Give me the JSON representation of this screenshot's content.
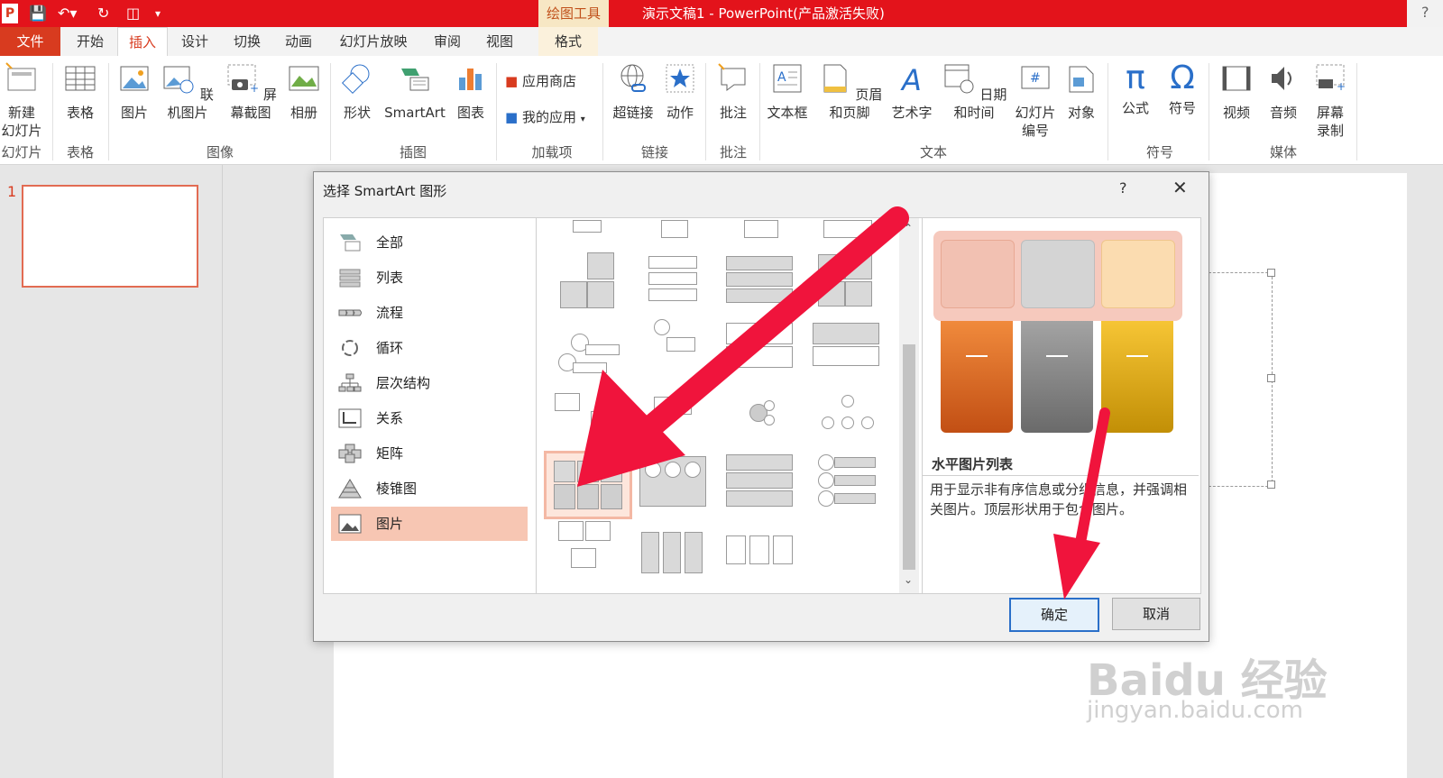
{
  "window": {
    "title": "演示文稿1 - PowerPoint(产品激活失败)",
    "context_tab_header": "绘图工具",
    "help": "?"
  },
  "tabs": [
    {
      "label": "文件"
    },
    {
      "label": "开始"
    },
    {
      "label": "插入"
    },
    {
      "label": "设计"
    },
    {
      "label": "切换"
    },
    {
      "label": "动画"
    },
    {
      "label": "幻灯片放映"
    },
    {
      "label": "审阅"
    },
    {
      "label": "视图"
    },
    {
      "label": "格式"
    }
  ],
  "active_tab": "插入",
  "ribbon": {
    "buttons": {
      "new_slide": "新建\n幻灯片",
      "table": "表格",
      "picture": "图片",
      "online_picture": "联机图片",
      "screenshot": "屏幕截图",
      "album": "相册",
      "shapes": "形状",
      "smartart": "SmartArt",
      "chart": "图表",
      "store": "应用商店",
      "my_apps": "我的应用",
      "hyperlink": "超链接",
      "action": "动作",
      "comment": "批注",
      "textbox": "文本框",
      "header_footer": "页眉和页脚",
      "wordart": "艺术字",
      "datetime": "日期和时间",
      "slide_number": "幻灯片\n编号",
      "object": "对象",
      "equation": "公式",
      "symbol": "符号",
      "video": "视频",
      "audio": "音频",
      "screen_record": "屏幕\n录制"
    },
    "groups": {
      "slides": "幻灯片",
      "tables": "表格",
      "images": "图像",
      "illustrations": "插图",
      "addins": "加载项",
      "links": "链接",
      "comments": "批注",
      "text": "文本",
      "symbols": "符号",
      "media": "媒体"
    }
  },
  "slide_panel": {
    "slide_number": "1"
  },
  "dialog": {
    "title": "选择 SmartArt 图形",
    "help": "?",
    "categories": [
      {
        "label": "全部",
        "icon": "all-icon"
      },
      {
        "label": "列表",
        "icon": "list-icon"
      },
      {
        "label": "流程",
        "icon": "process-icon"
      },
      {
        "label": "循环",
        "icon": "cycle-icon"
      },
      {
        "label": "层次结构",
        "icon": "hierarchy-icon"
      },
      {
        "label": "关系",
        "icon": "relationship-icon"
      },
      {
        "label": "矩阵",
        "icon": "matrix-icon"
      },
      {
        "label": "棱锥图",
        "icon": "pyramid-icon"
      },
      {
        "label": "图片",
        "icon": "picture-icon"
      }
    ],
    "selected_category": "图片",
    "preview": {
      "name": "水平图片列表",
      "description": "用于显示非有序信息或分组信息，并强调相关图片。顶层形状用于包含图片。",
      "colors": [
        "#e87d2e",
        "#8c8c8c",
        "#e8b71e"
      ]
    },
    "ok": "确定",
    "cancel": "取消"
  },
  "watermark": {
    "brand": "Baidu 经验",
    "url": "jingyan.baidu.com"
  }
}
